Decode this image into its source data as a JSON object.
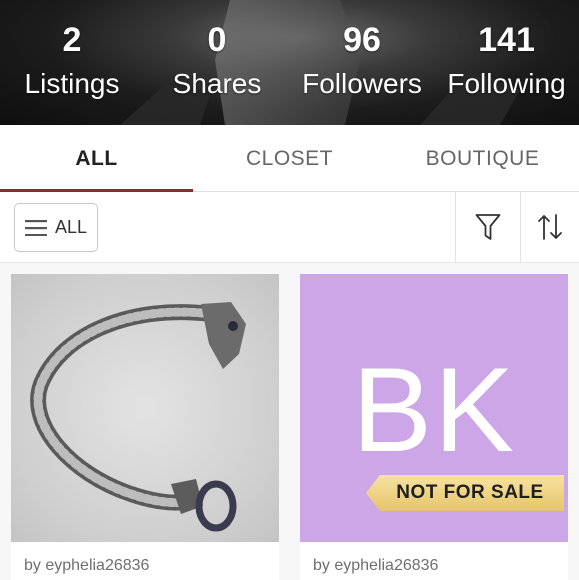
{
  "stats": [
    {
      "count": "2",
      "label": "Listings"
    },
    {
      "count": "0",
      "label": "Shares"
    },
    {
      "count": "96",
      "label": "Followers"
    },
    {
      "count": "141",
      "label": "Following"
    }
  ],
  "tabs": [
    {
      "label": "ALL",
      "active": true
    },
    {
      "label": "CLOSET",
      "active": false
    },
    {
      "label": "BOUTIQUE",
      "active": false
    }
  ],
  "filter": {
    "all_button_label": "ALL",
    "icons": [
      "hamburger-icon",
      "filter-icon",
      "sort-icon"
    ]
  },
  "listings": [
    {
      "image": "silver-dragon-bracelet",
      "byline": "by eyphelia26836"
    },
    {
      "image_text": "BK",
      "banner": "NOT FOR SALE",
      "byline": "by eyphelia26836"
    }
  ],
  "colors": {
    "accent": "#8c2d2d",
    "bk_background": "#cda6e8",
    "banner_gold": "#e5c46b"
  }
}
